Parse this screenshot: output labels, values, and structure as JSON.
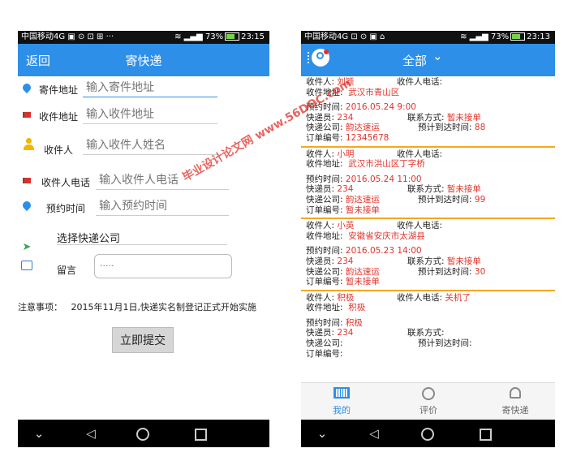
{
  "left": {
    "status": {
      "carrier": "中国移动4G",
      "icons": "▣ ⊙ ⊡ ⊞ ···",
      "signal": "73%",
      "time": "23:15"
    },
    "appbar": {
      "back_label": "返回",
      "title": "寄快递"
    },
    "form": {
      "sender_address": {
        "label": "寄件地址",
        "placeholder": "输入寄件地址",
        "icon": "location-pin-icon"
      },
      "receiver_address": {
        "label": "收件地址",
        "placeholder": "输入收件地址",
        "icon": "flag-icon"
      },
      "receiver_name": {
        "label": "收件人",
        "placeholder": "输入收件人姓名",
        "icon": "person-icon"
      },
      "receiver_phone": {
        "label": "收件人电话",
        "placeholder": "输入收件人电话",
        "icon": "flag-icon"
      },
      "appointment_time": {
        "label": "预约时间",
        "placeholder": "输入预约时间",
        "icon": "location-pin-icon"
      },
      "company": {
        "label": "选择快递公司",
        "icon": "send-icon"
      },
      "message": {
        "label": "留言",
        "placeholder": ".....",
        "icon": "image-icon"
      }
    },
    "notice": {
      "label": "注意事项：",
      "text": "2015年11月1日,快递实名制登记正式开始实施"
    },
    "submit_label": "立即提交"
  },
  "right": {
    "status": {
      "carrier": "中国移动4G",
      "icons": "⊡ ⊙ ▣ ⌂",
      "signal": "73%",
      "time": "23:13"
    },
    "appbar": {
      "title": "全部",
      "chevron": "⌄"
    },
    "labels": {
      "receiver": "收件人:",
      "receiver_phone": "收件人电话:",
      "receiver_address": "收件地址:",
      "appointment": "预约时间:",
      "courier": "快递员:",
      "contact": "联系方式:",
      "company": "快递公司:",
      "eta": "预计到达时间:",
      "order_no": "订单编号:"
    },
    "orders": [
      {
        "name": "刘颖",
        "phone": "",
        "address": "武汉市青山区",
        "time": "2016.05.24 9:00",
        "courier": "234",
        "contact": "暂未接单",
        "company": "韵达速运",
        "eta": "88",
        "order_no": "12345678"
      },
      {
        "name": "小明",
        "phone": "",
        "address": "武汉市洪山区丁字桥",
        "time": "2016.05.24 11:00",
        "courier": "234",
        "contact": "暂未接单",
        "company": "韵达速运",
        "eta": "99",
        "order_no": "暂未接单"
      },
      {
        "name": "小英",
        "phone": "",
        "address": "安徽省安庆市太湖县",
        "time": "2016.05.23 14:00",
        "courier": "234",
        "contact": "暂未接单",
        "company": "韵达速运",
        "eta": "30",
        "order_no": "暂未接单"
      },
      {
        "name": "积极",
        "phone": "关机了",
        "address": "积极",
        "time": "积极",
        "courier": "234",
        "contact": "",
        "company": "",
        "eta": "",
        "order_no": ""
      }
    ],
    "tabs": [
      {
        "label": "我的",
        "icon": "barcode-icon"
      },
      {
        "label": "评价",
        "icon": "search-icon"
      },
      {
        "label": "寄快递",
        "icon": "courier-icon"
      }
    ]
  },
  "watermark": "毕业设计论文网 www.56DOC.com",
  "colors": {
    "primary": "#2d8fe8",
    "accent_red": "#e0332b",
    "separator": "#f5a623"
  }
}
